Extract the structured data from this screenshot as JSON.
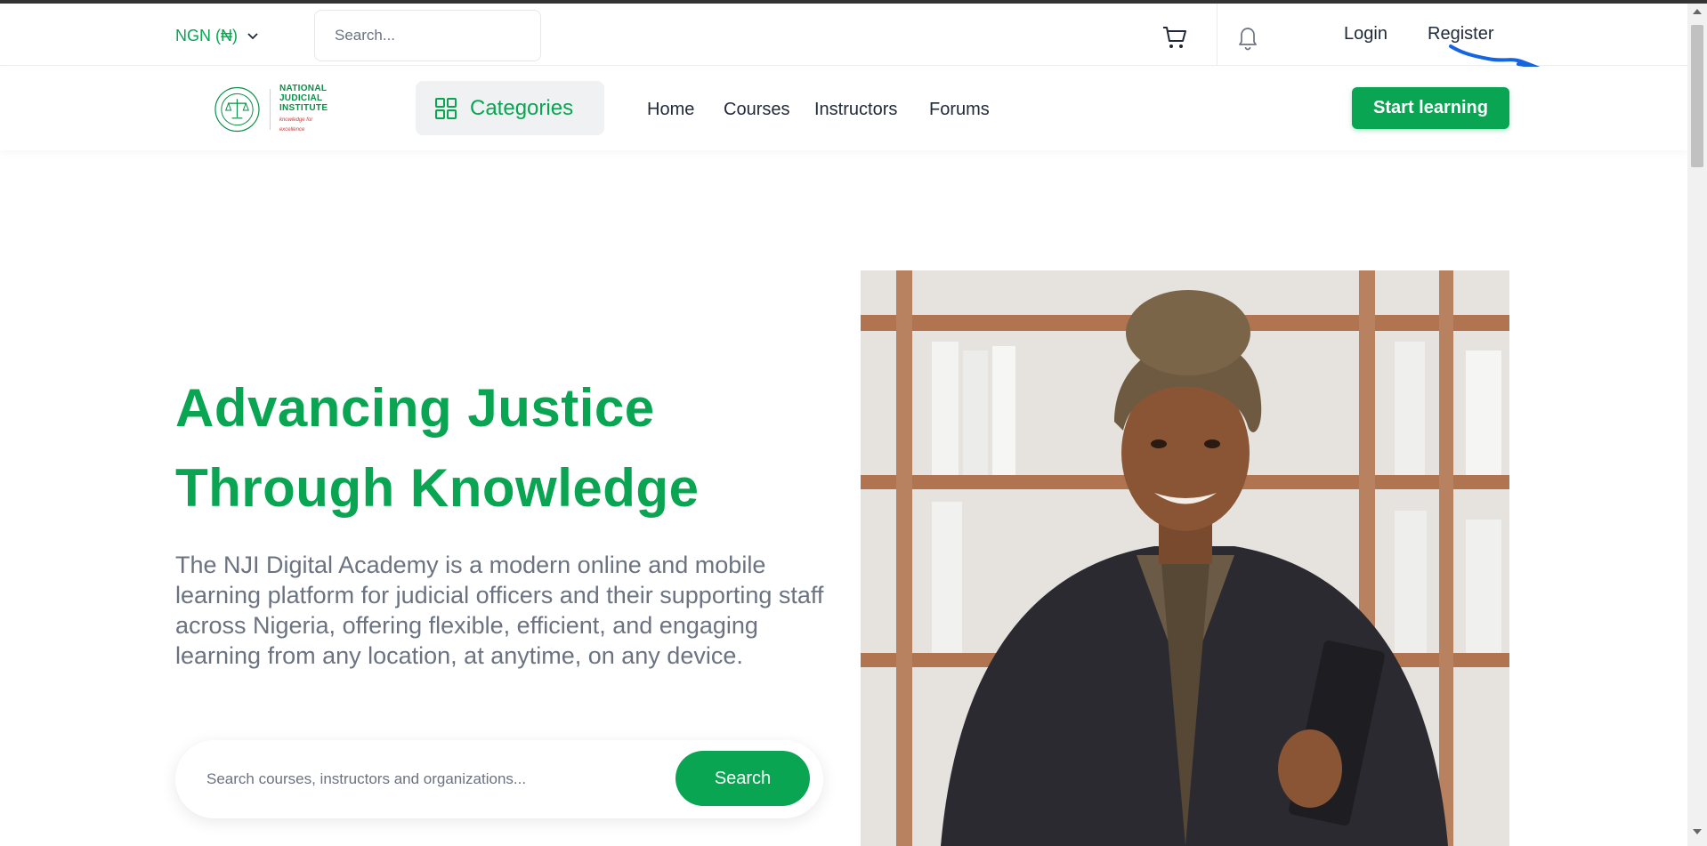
{
  "colors": {
    "brand": "#0aa552",
    "text": "#1f2937",
    "muted": "#6b7280",
    "annotation": "#1565e0"
  },
  "topbar": {
    "currency": "NGN (₦)",
    "search_placeholder": "Search...",
    "login": "Login",
    "register": "Register",
    "icons": [
      "chevron-down-icon",
      "search-icon",
      "cart-icon",
      "bell-icon"
    ]
  },
  "logo": {
    "line1": "NATIONAL",
    "line2": "JUDICIAL",
    "line3": "INSTITUTE",
    "tagline": "knowledge for excellence"
  },
  "nav": {
    "categories": "Categories",
    "links": [
      "Home",
      "Courses",
      "Instructors",
      "Forums"
    ],
    "cta": "Start learning"
  },
  "hero": {
    "title_line1": "Advancing Justice",
    "title_line2": "Through Knowledge",
    "description": "The NJI Digital Academy is a modern online and mobile learning platform for judicial officers and their supporting staff across Nigeria, offering flexible, efficient, and engaging learning from any location, at anytime, on any device.",
    "search_placeholder": "Search courses, instructors and organizations...",
    "search_button": "Search"
  }
}
